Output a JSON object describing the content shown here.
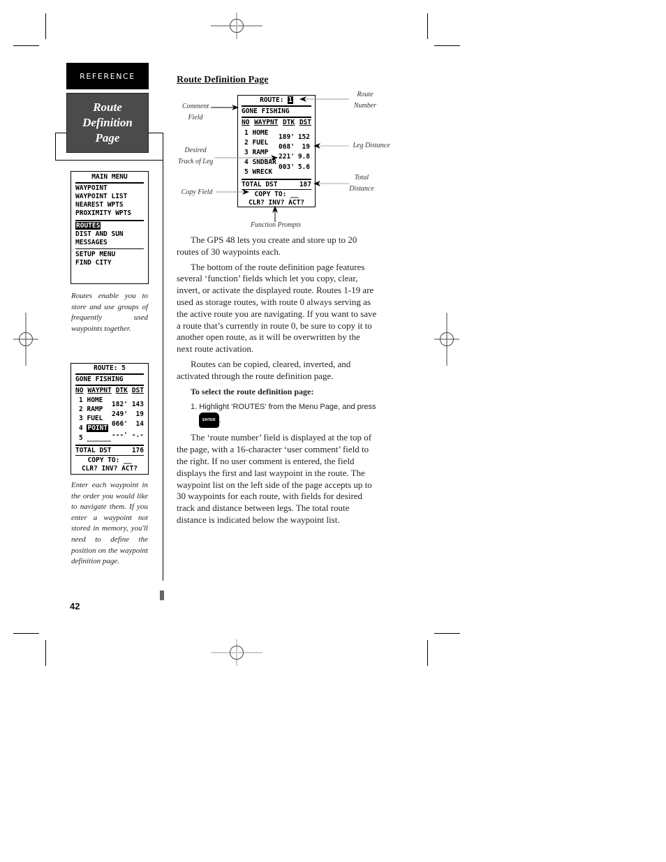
{
  "sidebar": {
    "section_tab": "REFERENCE",
    "title_line1": "Route Definition",
    "title_line2": "Page",
    "main_menu_screen": {
      "title": "MAIN MENU",
      "group1": [
        "WAYPOINT",
        "WAYPOINT LIST",
        "NEAREST WPTS",
        "PROXIMITY WPTS"
      ],
      "group2_highlighted": "ROUTES",
      "group2": [
        "DIST AND SUN",
        "MESSAGES"
      ],
      "group3": [
        "SETUP MENU",
        "FIND CITY"
      ]
    },
    "caption1": "Routes enable you to store and use groups of frequently used waypoints together.",
    "route5_screen": {
      "title": "ROUTE: 5",
      "comment": "GONE FISHING",
      "headers": [
        "NO",
        "WAYPNT",
        "DTK",
        "DST"
      ],
      "rows": [
        {
          "no": "1",
          "wpt": "HOME",
          "dtk": "",
          "dst": ""
        },
        {
          "no": "2",
          "wpt": "RAMP",
          "dtk": "182'",
          "dst": "143"
        },
        {
          "no": "3",
          "wpt": "FUEL",
          "dtk": "249'",
          "dst": "19"
        },
        {
          "no": "4",
          "wpt": "POINT",
          "dtk": "066'",
          "dst": "14"
        },
        {
          "no": "5",
          "wpt": "______",
          "dtk": "---'",
          "dst": "-.-"
        }
      ],
      "total_label": "TOTAL DST",
      "total_value": "176",
      "copy_to": "COPY TO: __",
      "functions": "CLR? INV? ACT?"
    },
    "caption2": "Enter each waypoint in the order you would like to navigate them. If you enter a waypoint not stored in memory, you'll need to define the position on the waypoint definition page."
  },
  "main": {
    "heading": "Route Definition Page",
    "figure": {
      "screen": {
        "title": "ROUTE:",
        "route_number": "1",
        "comment": "GONE FISHING",
        "headers": [
          "NO",
          "WAYPNT",
          "DTK",
          "DST"
        ],
        "rows": [
          {
            "no": "1",
            "wpt": "HOME"
          },
          {
            "no": "2",
            "wpt": "FUEL"
          },
          {
            "no": "3",
            "wpt": "RAMP"
          },
          {
            "no": "4",
            "wpt": "SNDBAR"
          },
          {
            "no": "5",
            "wpt": "WRECK"
          }
        ],
        "legs": [
          {
            "dtk": "189'",
            "dst": "152"
          },
          {
            "dtk": "068'",
            "dst": "19"
          },
          {
            "dtk": "221'",
            "dst": "9.8"
          },
          {
            "dtk": "003'",
            "dst": "5.6"
          }
        ],
        "total_label": "TOTAL DST",
        "total_value": "187",
        "copy_to": "COPY TO: __",
        "functions": "CLR? INV? ACT?"
      },
      "callouts": {
        "comment_field": [
          "Comment",
          "Field"
        ],
        "desired_track": [
          "Desired",
          "Track of Leg"
        ],
        "copy_field": "Copy Field",
        "route_number": [
          "Route",
          "Number"
        ],
        "leg_distance": "Leg Distance",
        "total_distance": [
          "Total",
          "Distance"
        ],
        "function_prompts": "Function Prompts"
      }
    },
    "paragraphs": [
      "The GPS 48 lets you create and store up to 20 routes of 30 waypoints each.",
      "The bottom of the route definition page features several ‘function’ fields which let you copy, clear, invert, or activate the displayed route.  Routes 1-19 are used as storage routes, with route 0 always serving as the active route you are navigating.  If you want to save a route that’s currently in route 0, be sure to copy it to another open route, as it will be overwritten by the next route activation.",
      "Routes can be copied, cleared, inverted, and activated through the route definition page."
    ],
    "subheading": "To select the route definition page:",
    "step1": "1. Highlight ‘ROUTES’ from the Menu Page, and press",
    "enter_key": "ENTER",
    "step1_end": ".",
    "paragraph_final": "The ‘route number’ field is displayed at the top of the page, with a 16-character ‘user comment’ field to the right.  If no user comment is entered, the field displays the first and last waypoint in the route.  The waypoint list on the left side of the page accepts up to 30 waypoints for each route, with fields for desired track and distance between legs.  The total route distance is indicated below the waypoint list."
  },
  "page_number": "42"
}
